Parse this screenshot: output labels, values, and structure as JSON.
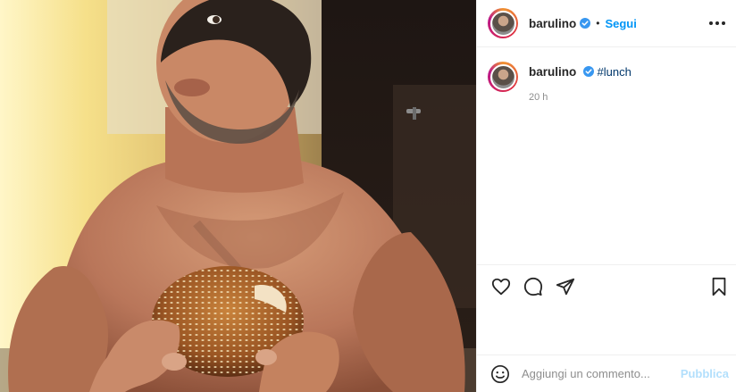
{
  "post": {
    "username": "barulino",
    "follow_label": "Segui",
    "separator": "•",
    "caption_user": "barulino",
    "caption_hashtag": "#lunch",
    "time_ago": "20 h",
    "comment_placeholder": "Aggiungi un commento...",
    "publish_label": "Pubblica"
  },
  "icons": {
    "verified": "verified-badge-icon",
    "more": "more-options-icon",
    "like": "heart-icon",
    "comment": "comment-bubble-icon",
    "share": "paper-plane-icon",
    "save": "bookmark-icon",
    "emoji": "emoji-smile-icon"
  },
  "colors": {
    "follow": "#0095f6",
    "verified": "#3897f0",
    "hashtag": "#00376b",
    "publish_disabled": "#b2dffc",
    "muted_text": "#8e8e8e",
    "border": "#efefef"
  }
}
